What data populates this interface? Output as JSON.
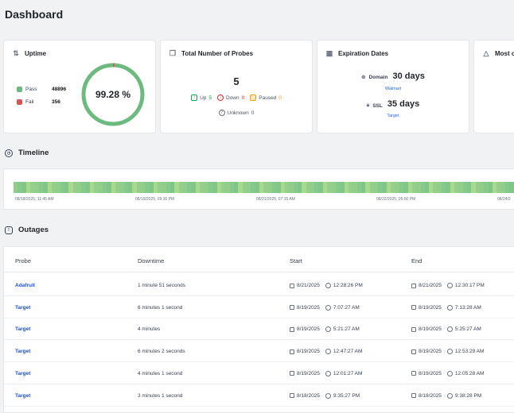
{
  "page": {
    "title": "Dashboard"
  },
  "colors": {
    "pass": "#6cba7d",
    "fail": "#d9534f",
    "link": "#1d4ed8",
    "up": "#16a34a",
    "down": "#dc2626",
    "paused": "#f59e0b"
  },
  "uptime": {
    "title": "Uptime",
    "icon": "sort-arrows-icon",
    "pass_label": "Pass",
    "pass_value": "48896",
    "fail_label": "Fail",
    "fail_value": "356",
    "percent_label": "99.28 %",
    "percent": 99.28
  },
  "probes": {
    "title": "Total Number of Probes",
    "icon": "copy-icon",
    "total": "5",
    "up_label": "Up",
    "up_value": "5",
    "down_label": "Down",
    "down_value": "0",
    "paused_label": "Paused",
    "paused_value": "0",
    "unknown_label": "Unknown",
    "unknown_value": "0"
  },
  "expiration": {
    "title": "Expiration Dates",
    "icon": "calendar-icon",
    "domain_label": "Domain",
    "domain_value": "30 days",
    "domain_target": "Walmart",
    "ssl_label": "SSL",
    "ssl_value": "35 days",
    "ssl_target": "Target"
  },
  "most": {
    "title": "Most o",
    "icon": "warning-icon"
  },
  "timeline": {
    "title": "Timeline",
    "ticks": [
      "08/18/2025, 11:45 AM",
      "08/19/2025, 09:30 PM",
      "08/21/2025, 07:15 AM",
      "08/22/2025, 05:00 PM",
      "08/24/2"
    ]
  },
  "outages": {
    "title": "Outages",
    "columns": {
      "probe": "Probe",
      "downtime": "Downtime",
      "start": "Start",
      "end": "End"
    },
    "rows": [
      {
        "probe": "Adafruit",
        "downtime": "1 minute 51 seconds",
        "start_date": "8/21/2025",
        "start_time": "12:28:26 PM",
        "end_date": "8/21/2025",
        "end_time": "12:30:17 PM"
      },
      {
        "probe": "Target",
        "downtime": "6 minutes 1 second",
        "start_date": "8/19/2025",
        "start_time": "7:07:27 AM",
        "end_date": "8/19/2025",
        "end_time": "7:13:28 AM"
      },
      {
        "probe": "Target",
        "downtime": "4 minutes",
        "start_date": "8/19/2025",
        "start_time": "5:21:27 AM",
        "end_date": "8/19/2025",
        "end_time": "5:25:27 AM"
      },
      {
        "probe": "Target",
        "downtime": "6 minutes 2 seconds",
        "start_date": "8/19/2025",
        "start_time": "12:47:27 AM",
        "end_date": "8/19/2025",
        "end_time": "12:53:29 AM"
      },
      {
        "probe": "Target",
        "downtime": "4 minutes 1 second",
        "start_date": "8/19/2025",
        "start_time": "12:01:27 AM",
        "end_date": "8/19/2025",
        "end_time": "12:05:28 AM"
      },
      {
        "probe": "Target",
        "downtime": "3 minutes 1 second",
        "start_date": "8/18/2025",
        "start_time": "9:35:27 PM",
        "end_date": "8/18/2025",
        "end_time": "9:38:28 PM"
      }
    ]
  }
}
